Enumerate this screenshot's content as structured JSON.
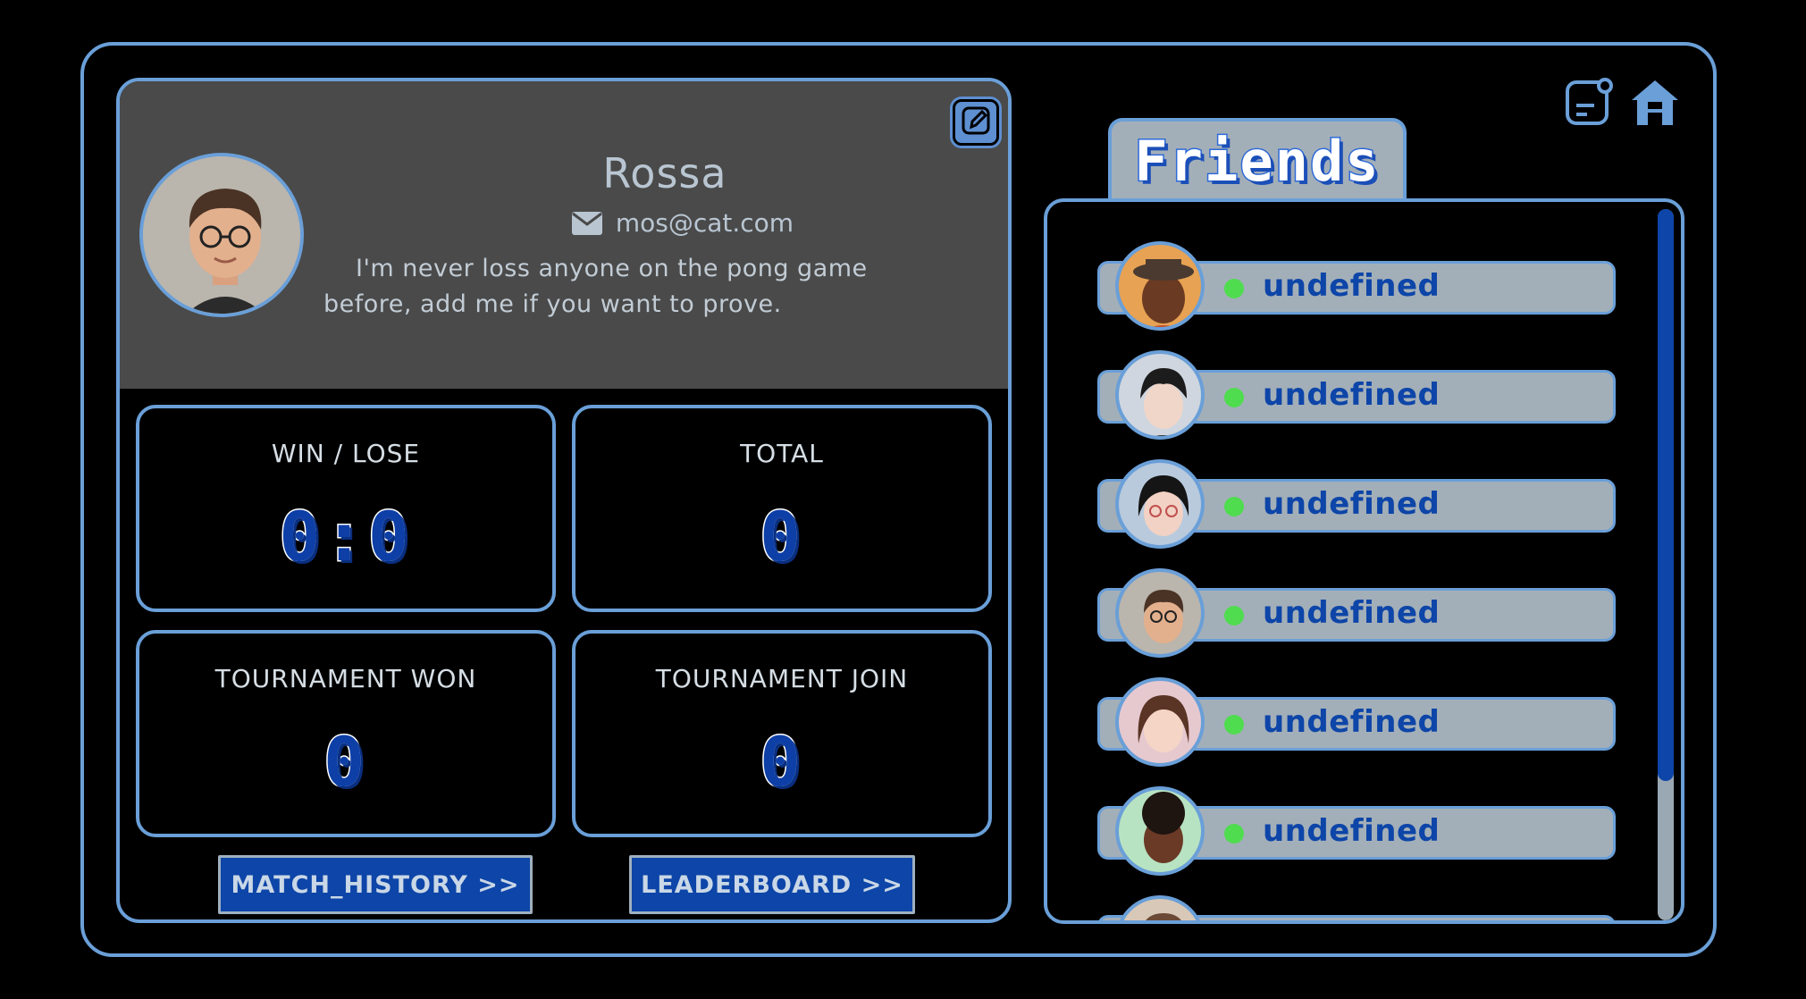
{
  "profile": {
    "username": "Rossa",
    "email": "mos@cat.com",
    "bio": "I'm never loss anyone on the pong game before, add me if you want to prove."
  },
  "stats": {
    "win_lose": {
      "label": "WIN / LOSE",
      "value": "0:0"
    },
    "total": {
      "label": "TOTAL",
      "value": "0"
    },
    "tournament_won": {
      "label": "TOURNAMENT WON",
      "value": "0"
    },
    "tournament_join": {
      "label": "TOURNAMENT JOIN",
      "value": "0"
    }
  },
  "buttons": {
    "match_history": "MATCH_HISTORY >>",
    "leaderboard": "LEADERBOARD >>"
  },
  "friends": {
    "title": "Friends",
    "items": [
      {
        "name": "undefined",
        "status": "online"
      },
      {
        "name": "undefined",
        "status": "online"
      },
      {
        "name": "undefined",
        "status": "online"
      },
      {
        "name": "undefined",
        "status": "online"
      },
      {
        "name": "undefined",
        "status": "online"
      },
      {
        "name": "undefined",
        "status": "online"
      },
      {
        "name": "",
        "status": ""
      }
    ]
  },
  "icons": {
    "edit": "edit-icon",
    "notes": "notes-icon",
    "home": "home-icon",
    "email": "envelope-icon"
  },
  "colors": {
    "accent": "#6a9fd8",
    "primary_blue": "#0d45a8",
    "online": "#4fdc4f",
    "header_bg": "#4a4a4a",
    "bar_bg": "#a3afb8"
  }
}
